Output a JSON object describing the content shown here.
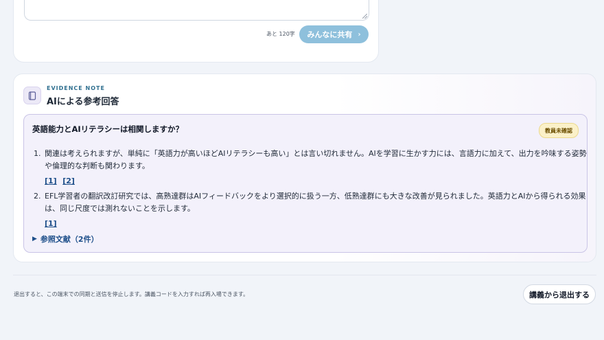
{
  "compose": {
    "char_count": "あと 120字",
    "share_label": "みんなに共有",
    "share_chevron": "›"
  },
  "evidence": {
    "eyebrow": "EVIDENCE NOTE",
    "title": "AIによる参考回答",
    "icon": "book-icon",
    "question": "英語能力とAIリテラシーは相関しますか？",
    "badge": "教員未確認",
    "answers": [
      {
        "text": "関連は考えられますが、単純に「英語力が高いほどAIリテラシーも高い」とは言い切れません。AIを学習に生かす力には、言語力に加えて、出力を吟味する姿勢や倫理的な判断も関わります。",
        "refs": [
          "[1]",
          "[2]"
        ]
      },
      {
        "text": "EFL学習者の翻訳改訂研究では、高熟達群はAIフィードバックをより選択的に扱う一方、低熟達群にも大きな改善が見られました。英語力とAIから得られる効果は、同じ尺度では測れないことを示します。",
        "refs": [
          "[1]"
        ]
      }
    ],
    "references_label": "参照文献（2件）"
  },
  "footer": {
    "note": "退出すると、この端末での同期と送信を停止します。講義コードを入力すれば再入場できます。",
    "exit_label": "講義から退出する"
  },
  "colors": {
    "share_button": "#8ec0dc",
    "eyebrow": "#2f6f8f",
    "link": "#1e4f8a",
    "badge_bg": "#fbf1c9",
    "answer_bg": "#f3f1fb"
  }
}
